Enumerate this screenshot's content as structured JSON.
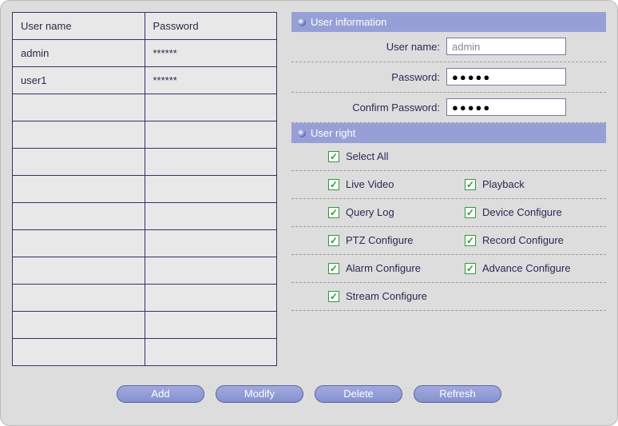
{
  "table": {
    "headers": {
      "username": "User name",
      "password": "Password"
    },
    "rows": [
      {
        "username": "admin",
        "password": "******"
      },
      {
        "username": "user1",
        "password": "******"
      }
    ],
    "emptyRows": 10
  },
  "userInfo": {
    "title": "User information",
    "usernameLabel": "User name:",
    "usernameValue": "admin",
    "passwordLabel": "Password:",
    "passwordValue": "●●●●●",
    "confirmLabel": "Confirm Password:",
    "confirmValue": "●●●●●"
  },
  "userRight": {
    "title": "User right",
    "selectAll": {
      "label": "Select All",
      "checked": true
    },
    "rights": [
      {
        "label": "Live Video",
        "checked": true
      },
      {
        "label": "Playback",
        "checked": true
      },
      {
        "label": "Query Log",
        "checked": true
      },
      {
        "label": "Device Configure",
        "checked": true
      },
      {
        "label": "PTZ Configure",
        "checked": true
      },
      {
        "label": "Record Configure",
        "checked": true
      },
      {
        "label": "Alarm Configure",
        "checked": true
      },
      {
        "label": "Advance Configure",
        "checked": true
      },
      {
        "label": "Stream Configure",
        "checked": true
      }
    ]
  },
  "buttons": {
    "add": "Add",
    "modify": "Modify",
    "delete": "Delete",
    "refresh": "Refresh"
  }
}
